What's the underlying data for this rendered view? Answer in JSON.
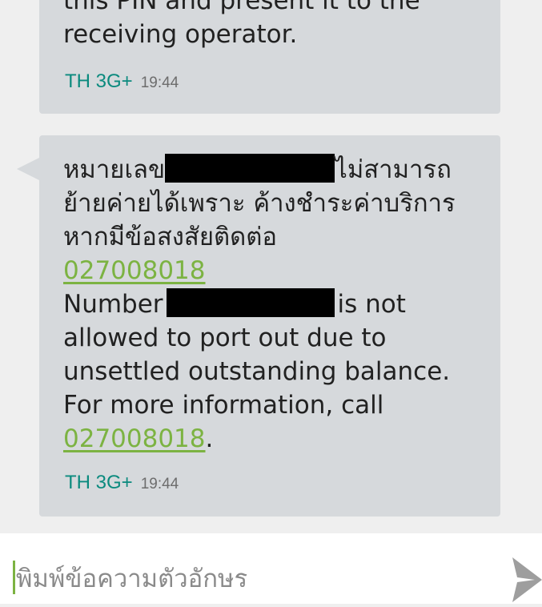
{
  "messages": [
    {
      "text": "this PIN and present it to the receiving operator.",
      "carrier": "TH 3G+",
      "time": "19:44"
    },
    {
      "thai_prefix": "หมายเลข",
      "thai_middle": "ไม่สามารถย้ายค่ายได้เพราะ ค้างชำระค่าบริการ หากมีข้อสงสัยติดต่อ",
      "phone": "027008018",
      "en_prefix": "Number",
      "en_middle": "is not allowed to port out due to unsettled outstanding balance. For more information, call",
      "period": ".",
      "carrier": "TH 3G+",
      "time": "19:44"
    }
  ],
  "composer": {
    "placeholder": "พิมพ์ข้อความตัวอักษร"
  },
  "icons": {
    "send": "send-icon"
  },
  "colors": {
    "background": "#efefef",
    "bubble": "#d6d9dc",
    "link": "#7cb342",
    "carrier": "#0b8a7e",
    "send_icon": "#9e9e9e"
  }
}
